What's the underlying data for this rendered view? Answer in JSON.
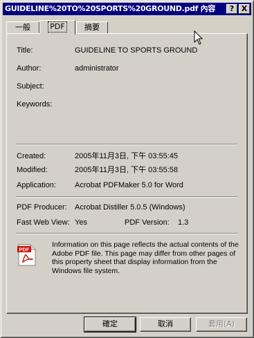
{
  "window": {
    "title": "GUIDELINE%20TO%20SPORTS%20GROUND.pdf 內容"
  },
  "titlebar": {
    "help_label": "?",
    "close_label": "X"
  },
  "tabs": [
    {
      "label": "一般"
    },
    {
      "label": "PDF"
    },
    {
      "label": "摘要"
    }
  ],
  "document": {
    "title_label": "Title:",
    "title_value": "GUIDELINE TO SPORTS GROUND",
    "author_label": "Author:",
    "author_value": "administrator",
    "subject_label": "Subject:",
    "subject_value": "",
    "keywords_label": "Keywords:",
    "keywords_value": ""
  },
  "dates": {
    "created_label": "Created:",
    "created_value": "2005年11月3日, 下午 03:55:45",
    "modified_label": "Modified:",
    "modified_value": "2005年11月3日, 下午 03:55:58",
    "application_label": "Application:",
    "application_value": "Acrobat PDFMaker 5.0 for Word"
  },
  "pdf": {
    "producer_label": "PDF Producer:",
    "producer_value": "Acrobat Distiller 5.0.5 (Windows)",
    "fastweb_label": "Fast Web View:",
    "fastweb_value": "Yes",
    "version_label": "PDF Version:",
    "version_value": "1.3"
  },
  "info": {
    "icon_name": "pdf-file-icon",
    "icon_text": "PDF",
    "text": "Information on this page reflects the actual contents of the Adobe PDF file. This page may differ from other pages of this property sheet that display information from the Windows file system."
  },
  "buttons": {
    "ok_label": "確定",
    "cancel_label": "取消",
    "apply_label": "套用(A)"
  }
}
